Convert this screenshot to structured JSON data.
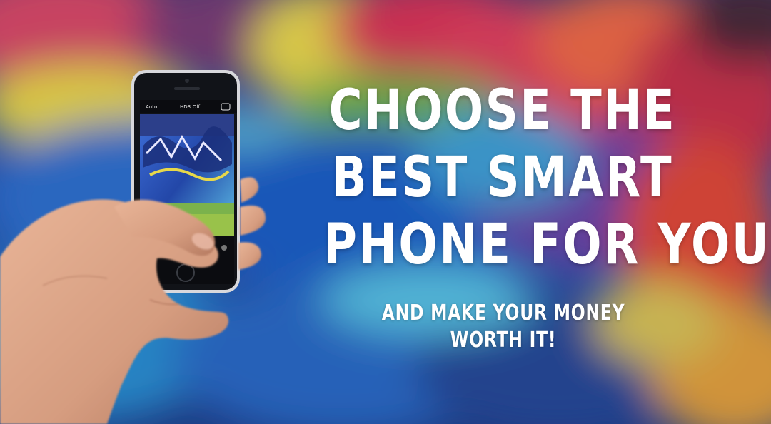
{
  "headline": {
    "line1": "CHOOSE THE",
    "line2": "BEST SMART",
    "line3": "PHONE FOR YOU!"
  },
  "subline": "AND MAKE YOUR MONEY WORTH IT!",
  "phone": {
    "status_left": "Auto",
    "status_center": "HDR Off"
  },
  "colors": {
    "text": "#ffffff",
    "graffiti_blue": "#2f6fd0",
    "graffiti_red": "#d8345a",
    "graffiti_yellow": "#e9d84a",
    "graffiti_green": "#5fa34a"
  }
}
